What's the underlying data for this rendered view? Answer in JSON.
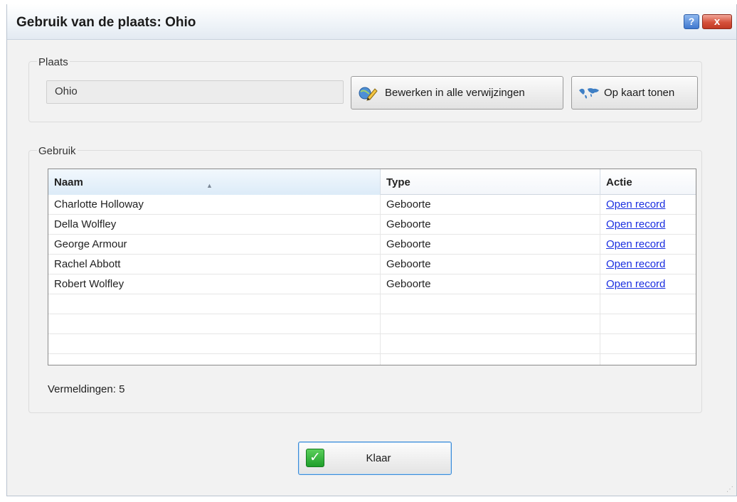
{
  "window": {
    "title": "Gebruik van de plaats: Ohio",
    "help_glyph": "?",
    "close_glyph": "x"
  },
  "plaats": {
    "legend": "Plaats",
    "value": "Ohio",
    "edit_button": "Bewerken in alle verwijzingen",
    "map_button": "Op kaart tonen"
  },
  "gebruik": {
    "legend": "Gebruik",
    "columns": [
      "Naam",
      "Type",
      "Actie"
    ],
    "rows": [
      {
        "naam": "Charlotte Holloway",
        "type": "Geboorte",
        "actie": "Open record"
      },
      {
        "naam": "Della Wolfley",
        "type": "Geboorte",
        "actie": "Open record"
      },
      {
        "naam": "George Armour",
        "type": "Geboorte",
        "actie": "Open record"
      },
      {
        "naam": "Rachel Abbott",
        "type": "Geboorte",
        "actie": "Open record"
      },
      {
        "naam": "Robert Wolfley",
        "type": "Geboorte",
        "actie": "Open record"
      }
    ],
    "count_label": "Vermeldingen: 5"
  },
  "footer": {
    "done_button": "Klaar"
  },
  "colors": {
    "link": "#1a2fe0",
    "header_selected": "#dcebf8",
    "check": "#1e9e2a",
    "close": "#d5513b"
  },
  "icons": {
    "edit": "pencil-globe-icon",
    "map": "world-map-icon",
    "done": "checkmark-icon",
    "sort": "sort-ascending-icon"
  }
}
